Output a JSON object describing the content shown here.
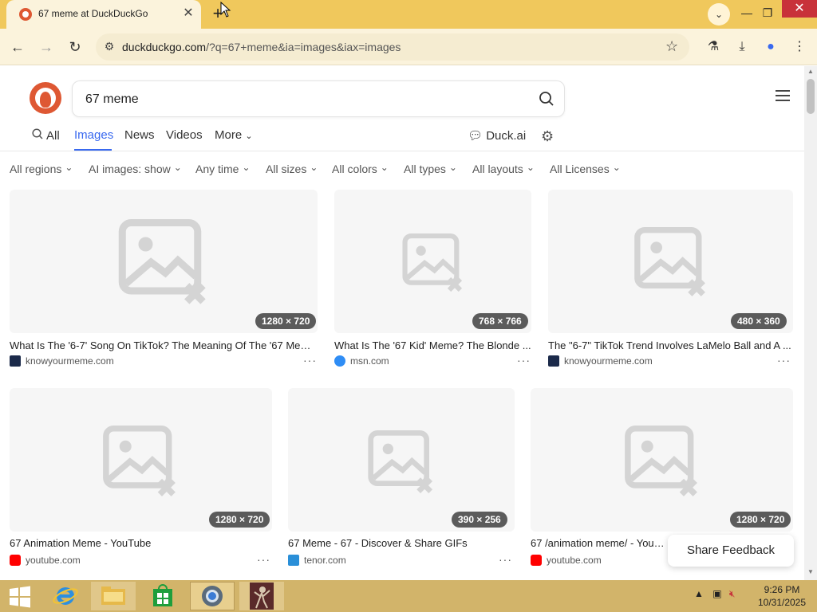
{
  "browser": {
    "tab_title": "67 meme at DuckDuckGo",
    "url_host": "duckduckgo.com",
    "url_rest": "/?q=67+meme&ia=images&iax=images"
  },
  "search": {
    "query": "67 meme"
  },
  "nav_tabs": {
    "all": "All",
    "images": "Images",
    "news": "News",
    "videos": "Videos",
    "more": "More",
    "duck_ai": "Duck.ai"
  },
  "filters": [
    "All regions",
    "AI images: show",
    "Any time",
    "All sizes",
    "All colors",
    "All types",
    "All layouts",
    "All Licenses"
  ],
  "results": [
    {
      "title": "What Is The '6-7' Song On TikTok? The Meaning Of The '67 Mem...",
      "source": "knowyourmeme.com",
      "dims": "1280 × 720",
      "fav_color": "#1b2a4a"
    },
    {
      "title": "What Is The '67 Kid' Meme? The Blonde ...",
      "source": "msn.com",
      "dims": "768 × 766",
      "fav_color": "#2f8df5"
    },
    {
      "title": "The \"6-7\" TikTok Trend Involves LaMelo Ball and A ...",
      "source": "knowyourmeme.com",
      "dims": "480 × 360",
      "fav_color": "#1b2a4a"
    },
    {
      "title": "67 Animation Meme - YouTube",
      "source": "youtube.com",
      "dims": "1280 × 720",
      "fav_color": "#ff0000"
    },
    {
      "title": "67 Meme - 67 - Discover & Share GIFs",
      "source": "tenor.com",
      "dims": "390 × 256",
      "fav_color": "#2a8fd8"
    },
    {
      "title": "67 /animation meme/ - YouTube",
      "source": "youtube.com",
      "dims": "1280 × 720",
      "fav_color": "#ff0000"
    }
  ],
  "feedback": "Share Feedback",
  "taskbar": {
    "time": "9:26 PM",
    "date": "10/31/2025"
  },
  "colors": {
    "accent": "#3969ef",
    "brand": "#de5833",
    "chrome": "#f0c85c"
  }
}
